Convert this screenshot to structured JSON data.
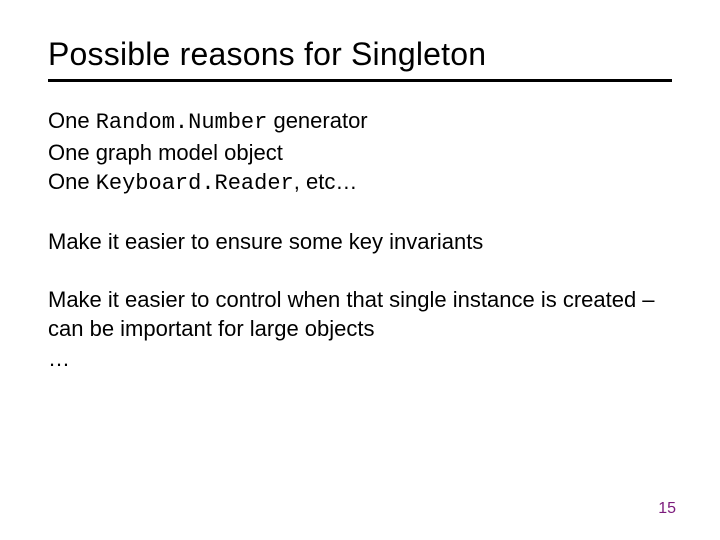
{
  "slide": {
    "title": "Possible reasons for Singleton",
    "lines": {
      "l1a": "One ",
      "l1b": "Random.Number",
      "l1c": " generator",
      "l2": "One graph model object",
      "l3a": "One ",
      "l3b": "Keyboard.Reader",
      "l3c": ", etc…",
      "l4": "Make it easier to ensure some key invariants",
      "l5": "Make it easier to control when that single instance is created – can be important for large objects",
      "l6": "…"
    },
    "page_number": "15"
  }
}
